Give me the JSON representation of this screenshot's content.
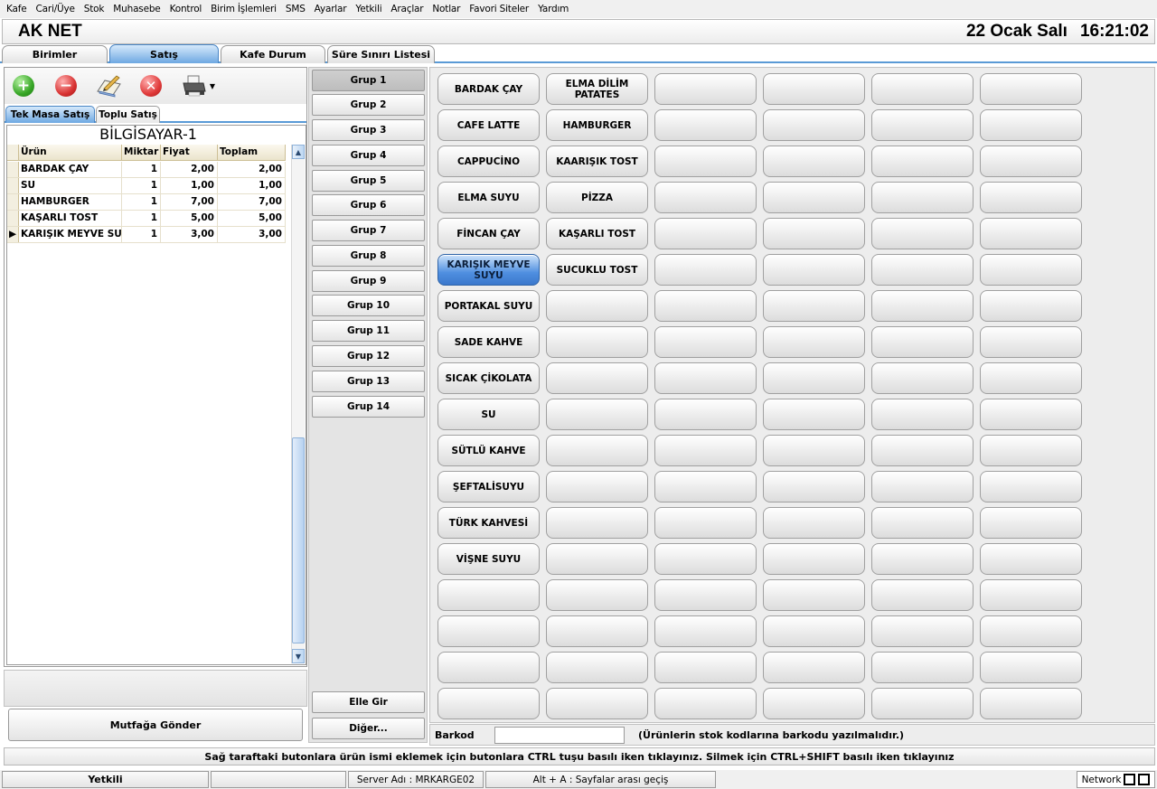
{
  "menu": [
    "Kafe",
    "Cari/Üye",
    "Stok",
    "Muhasebe",
    "Kontrol",
    "Birim İşlemleri",
    "SMS",
    "Ayarlar",
    "Yetkili",
    "Araçlar",
    "Notlar",
    "Favori Siteler",
    "Yardım"
  ],
  "header": {
    "app_name": "AK NET",
    "date": "22 Ocak Salı",
    "time": "16:21:02"
  },
  "main_tabs": [
    "Birimler",
    "Satış",
    "Kafe Durum",
    "Süre Sınırı Listesi"
  ],
  "main_tab_active": "Satış",
  "toolbar_icons": [
    "add-icon",
    "minus-icon",
    "edit-note-icon",
    "delete-icon",
    "printer-icon",
    "dropdown-arrow-icon"
  ],
  "sub_tabs": [
    "Tek Masa Satış",
    "Toplu Satış"
  ],
  "sub_tab_active": "Tek Masa Satış",
  "table_name": "BİLGİSAYAR-1",
  "grid": {
    "columns": [
      "Ürün",
      "Miktar",
      "Fiyat",
      "Toplam"
    ],
    "rows": [
      [
        "BARDAK ÇAY",
        "1",
        "2,00",
        "2,00"
      ],
      [
        "SU",
        "1",
        "1,00",
        "1,00"
      ],
      [
        "HAMBURGER",
        "1",
        "7,00",
        "7,00"
      ],
      [
        "KAŞARLI TOST",
        "1",
        "5,00",
        "5,00"
      ],
      [
        "KARIŞIK MEYVE SUYU",
        "1",
        "3,00",
        "3,00"
      ]
    ],
    "current_row_marker": "▶"
  },
  "kitchen_button": "Mutfağa Gönder",
  "groups": [
    "Grup 1",
    "Grup 2",
    "Grup 3",
    "Grup 4",
    "Grup 5",
    "Grup 6",
    "Grup 7",
    "Grup 8",
    "Grup 9",
    "Grup 10",
    "Grup 11",
    "Grup 12",
    "Grup 13",
    "Grup 14"
  ],
  "group_active": "Grup 1",
  "manual_entry_button": "Elle Gir",
  "other_button": "Diğer...",
  "product_columns": [
    [
      "BARDAK ÇAY",
      "CAFE LATTE",
      "CAPPUCİNO",
      "ELMA SUYU",
      "FİNCAN ÇAY",
      "KARIŞIK MEYVE SUYU",
      "PORTAKAL SUYU",
      "SADE KAHVE",
      "SICAK ÇİKOLATA",
      "SU",
      "SÜTLÜ KAHVE",
      "ŞEFTALİSUYU",
      "TÜRK KAHVESİ",
      "VİŞNE SUYU",
      "",
      "",
      "",
      ""
    ],
    [
      "ELMA DİLİM PATATES",
      "HAMBURGER",
      "KAARIŞIK TOST",
      "PİZZA",
      "KAŞARLI TOST",
      "SUCUKLU TOST",
      "",
      "",
      "",
      "",
      "",
      "",
      "",
      "",
      "",
      "",
      "",
      ""
    ],
    [
      "",
      "",
      "",
      "",
      "",
      "",
      "",
      "",
      "",
      "",
      "",
      "",
      "",
      "",
      "",
      "",
      "",
      ""
    ],
    [
      "",
      "",
      "",
      "",
      "",
      "",
      "",
      "",
      "",
      "",
      "",
      "",
      "",
      "",
      "",
      "",
      "",
      ""
    ],
    [
      "",
      "",
      "",
      "",
      "",
      "",
      "",
      "",
      "",
      "",
      "",
      "",
      "",
      "",
      "",
      "",
      "",
      ""
    ],
    [
      "",
      "",
      "",
      "",
      "",
      "",
      "",
      "",
      "",
      "",
      "",
      "",
      "",
      "",
      "",
      "",
      "",
      ""
    ]
  ],
  "product_active": "KARIŞIK MEYVE SUYU",
  "barcode": {
    "label": "Barkod",
    "value": "",
    "hint": "(Ürünlerin stok kodlarına barkodu yazılmalıdır.)"
  },
  "info_text": "Sağ taraftaki butonlara ürün ismi eklemek için butonlara CTRL tuşu basılı iken tıklayınız. Silmek için CTRL+SHIFT basılı iken tıklayınız",
  "status": {
    "user": "Yetkili",
    "empty": "",
    "server": "Server Adı : MRKARGE02",
    "shortcut": "Alt + A : Sayfalar arası geçiş",
    "network": "Network"
  },
  "colors": {
    "accent": "#5a9ad6",
    "active_product": "#4f8fe0",
    "panel_bg": "#ededed"
  }
}
